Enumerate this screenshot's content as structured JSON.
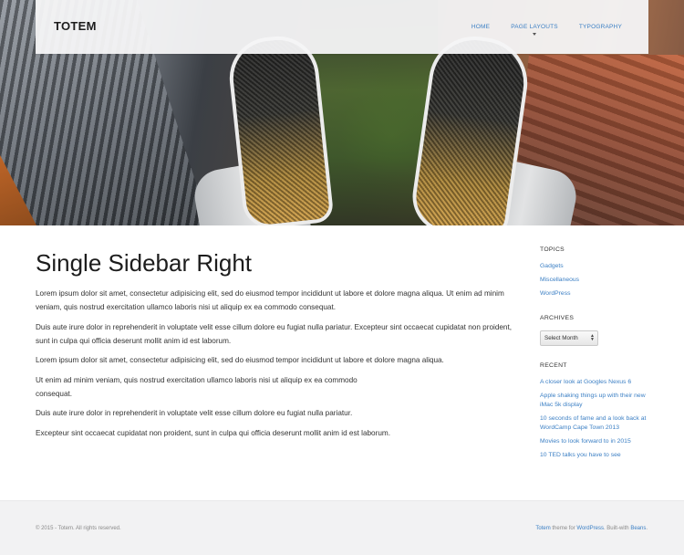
{
  "header": {
    "logo": "TOTEM",
    "nav": [
      "HOME",
      "PAGE LAYOUTS",
      "TYPOGRAPHY"
    ]
  },
  "main": {
    "title": "Single Sidebar Right",
    "paragraphs": [
      "Lorem ipsum dolor sit amet, consectetur adipisicing elit, sed do eiusmod tempor incididunt ut labore et dolore magna aliqua. Ut enim ad minim veniam, quis nostrud exercitation ullamco laboris nisi ut aliquip ex ea commodo consequat.",
      "Duis aute irure dolor in reprehenderit in voluptate velit esse cillum dolore eu fugiat nulla pariatur. Excepteur sint occaecat cupidatat non proident, sunt in culpa qui officia deserunt mollit anim id est laborum.",
      "Lorem ipsum dolor sit amet, consectetur adipisicing elit, sed do eiusmod tempor incididunt ut labore et dolore magna aliqua.",
      "Ut enim ad minim veniam, quis nostrud exercitation ullamco laboris nisi ut aliquip ex ea commodo",
      "consequat.",
      "Duis aute irure dolor in reprehenderit in voluptate velit esse cillum dolore eu fugiat nulla pariatur.",
      "Excepteur sint occaecat cupidatat non proident, sunt in culpa qui officia deserunt mollit anim id est laborum."
    ]
  },
  "sidebar": {
    "topics_title": "TOPICS",
    "topics": [
      "Gadgets",
      "Miscellaneous",
      "WordPress"
    ],
    "archives_title": "ARCHIVES",
    "archives_select": "Select Month",
    "recent_title": "RECENT",
    "recent": [
      "A closer look at Googles Nexus 6",
      "Apple shaking things up with their new iMac 5k display",
      "10 seconds of fame and a look back at WordCamp Cape Town 2013",
      "Movies to look forward to in 2015",
      "10 TED talks you have to see"
    ]
  },
  "footer": {
    "copyright": "© 2015 - Totem. All rights reserved.",
    "credit_link_theme": "Totem",
    "credit_text_1": " theme for ",
    "credit_link_wp": "WordPress",
    "credit_text_2": ". Built-with ",
    "credit_link_beans": "Beans",
    "credit_text_3": "."
  },
  "colors": {
    "link": "#3b7fc4",
    "title": "#1d1d1d",
    "footer_bg": "#f2f2f3"
  }
}
